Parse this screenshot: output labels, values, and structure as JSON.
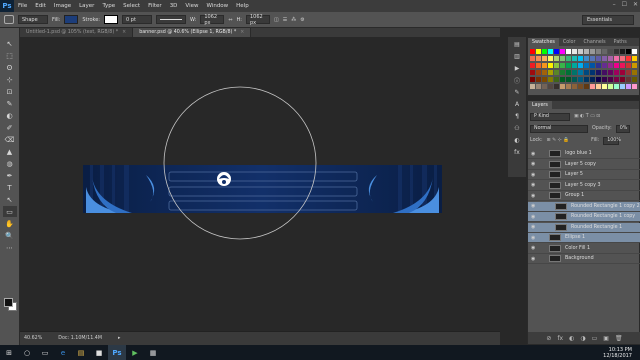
{
  "app": {
    "logo": "Ps",
    "menu": [
      "File",
      "Edit",
      "Image",
      "Layer",
      "Type",
      "Select",
      "Filter",
      "3D",
      "View",
      "Window",
      "Help"
    ],
    "window_controls": [
      "–",
      "☐",
      "✕"
    ]
  },
  "options_bar": {
    "mode": "Shape",
    "fill_label": "Fill:",
    "fill_color": "#1c3d7a",
    "stroke_label": "Stroke:",
    "stroke_width": "0 pt",
    "w_label": "W:",
    "w_value": "1062 px",
    "h_label": "H:",
    "h_value": "1062 px",
    "workspace": "Essentials"
  },
  "tabs": [
    {
      "label": "Untitled-1.psd @ 105% (text, RGB/8) *",
      "close": "×",
      "active": false
    },
    {
      "label": "banner.psd @ 40.6% (Ellipse 1, RGB/8) *",
      "close": "×",
      "active": true
    }
  ],
  "tools": [
    "↖",
    "⬚",
    "ʘ",
    "⊹",
    "⊡",
    "✎",
    "◐",
    "✐",
    "⌫",
    "▲",
    "◍",
    "✒",
    "T",
    "↖",
    "▭",
    "✋",
    "🔍",
    "⋯"
  ],
  "status": {
    "zoom": "40.62%",
    "doc": "Doc: 1.10M/11.4M"
  },
  "swatches_panel": {
    "tabs": [
      "Swatches",
      "Color",
      "Channels",
      "Paths"
    ],
    "colors": [
      "#ff0000",
      "#ffff00",
      "#00ff00",
      "#00ffff",
      "#0000ff",
      "#ff00ff",
      "#ffffff",
      "#e6e6e6",
      "#cccccc",
      "#b3b3b3",
      "#999999",
      "#808080",
      "#666666",
      "#4d4d4d",
      "#333333",
      "#1a1a1a",
      "#000000",
      "#ffffff",
      "#f26c4f",
      "#f68e55",
      "#fbaf5c",
      "#fff467",
      "#acd372",
      "#7cc576",
      "#3bb878",
      "#1abbb4",
      "#00bff3",
      "#438cca",
      "#5574b9",
      "#605ca8",
      "#855fa8",
      "#a763a8",
      "#f06ea9",
      "#f26d7d",
      "#ff3333",
      "#ffcc00",
      "#ed1c24",
      "#f26522",
      "#f7941d",
      "#fff200",
      "#8dc73f",
      "#39b54a",
      "#00a651",
      "#00a99d",
      "#00aeef",
      "#0072bc",
      "#0054a6",
      "#2e3192",
      "#662d91",
      "#92278f",
      "#ec008c",
      "#ed145b",
      "#cc3333",
      "#cc9900",
      "#9e0b0f",
      "#a0410d",
      "#a3620a",
      "#aba000",
      "#598527",
      "#197b30",
      "#007236",
      "#00746b",
      "#0076a3",
      "#004a80",
      "#003471",
      "#1b1464",
      "#440e62",
      "#630460",
      "#9e005d",
      "#9e0039",
      "#993333",
      "#997300",
      "#790000",
      "#7b2e00",
      "#7d4900",
      "#827b00",
      "#406618",
      "#005e20",
      "#005826",
      "#005952",
      "#005b7f",
      "#003663",
      "#002157",
      "#0d004c",
      "#32004b",
      "#4b0049",
      "#7b0046",
      "#7a0026",
      "#663333",
      "#665a00",
      "#c7b299",
      "#998675",
      "#736357",
      "#534741",
      "#37302d",
      "#c69c6d",
      "#a67c52",
      "#8c6239",
      "#754c24",
      "#603913",
      "#ff9999",
      "#ffcc99",
      "#ffff99",
      "#ccff99",
      "#99ffcc",
      "#99ccff",
      "#cc99ff",
      "#ff99cc"
    ]
  },
  "layers_panel": {
    "title": "Layers",
    "kind": "P Kind",
    "blend_mode": "Normal",
    "opacity_label": "Opacity:",
    "opacity_value": "0%",
    "lock_label": "Lock:",
    "fill_label": "Fill:",
    "fill_value": "100%",
    "layers": [
      {
        "name": "logo blue 1",
        "selected": false,
        "indent": 0
      },
      {
        "name": "Layer 5 copy",
        "selected": false,
        "indent": 0
      },
      {
        "name": "Layer 5",
        "selected": false,
        "indent": 0
      },
      {
        "name": "Layer 5 copy 3",
        "selected": false,
        "indent": 0
      },
      {
        "name": "Group 1",
        "selected": false,
        "indent": 0
      },
      {
        "name": "Rounded Rectangle 1 copy 2",
        "selected": true,
        "indent": 1
      },
      {
        "name": "Rounded Rectangle 1 copy",
        "selected": true,
        "indent": 1
      },
      {
        "name": "Rounded Rectangle 1",
        "selected": true,
        "indent": 1
      },
      {
        "name": "Ellipse 1",
        "selected": true,
        "indent": 0
      },
      {
        "name": "Color Fill 1",
        "selected": false,
        "indent": 0
      },
      {
        "name": "Background",
        "selected": false,
        "indent": 0
      }
    ],
    "footer": [
      "⊘",
      "fx",
      "◐",
      "◑",
      "▭",
      "▣",
      "🗑"
    ]
  },
  "taskbar": {
    "icons": [
      "⊞",
      "○",
      "▭",
      "e",
      "▤",
      "■",
      "Ps",
      "▶",
      "▦"
    ],
    "time": "10:13 PM",
    "date": "12/18/2017"
  },
  "colors": {
    "banner_bg": "#0e2a5c",
    "banner_accent": "#4a8fe0",
    "selection": "#7b8fa6"
  }
}
